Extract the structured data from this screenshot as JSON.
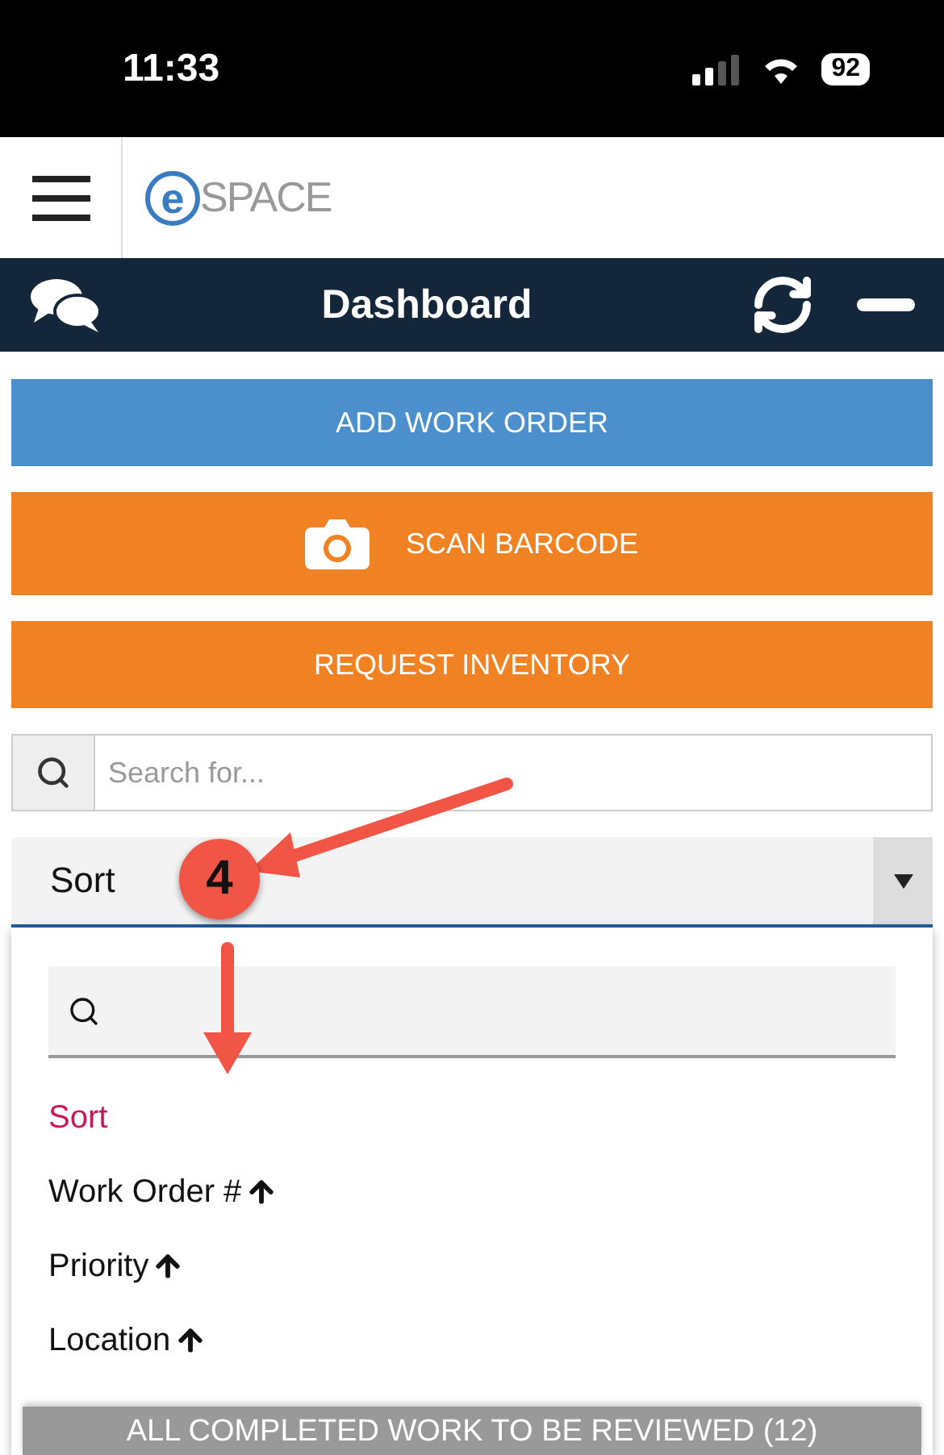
{
  "status_bar": {
    "time": "11:33",
    "battery": "92"
  },
  "header": {
    "logo_letter": "e",
    "logo_text": "SPACE"
  },
  "nav_bar": {
    "title": "Dashboard"
  },
  "actions": [
    {
      "label": "ADD WORK ORDER",
      "kind": "plain",
      "color": "#4b8fcc"
    },
    {
      "label": "SCAN BARCODE",
      "kind": "camera",
      "color": "#f08223"
    },
    {
      "label": "REQUEST INVENTORY",
      "kind": "plain",
      "color": "#f08223"
    }
  ],
  "search": {
    "placeholder": "Search for..."
  },
  "sort_select": {
    "value": "Sort",
    "expanded": true
  },
  "sort_options": [
    {
      "label": "Sort",
      "selected": true,
      "ascending": false
    },
    {
      "label": "Work Order #",
      "selected": false,
      "ascending": true
    },
    {
      "label": "Priority",
      "selected": false,
      "ascending": true
    },
    {
      "label": "Location",
      "selected": false,
      "ascending": true
    }
  ],
  "callout": {
    "number": "4"
  },
  "bottom_bar": {
    "label": "ALL COMPLETED WORK TO BE REVIEWED (12)"
  }
}
